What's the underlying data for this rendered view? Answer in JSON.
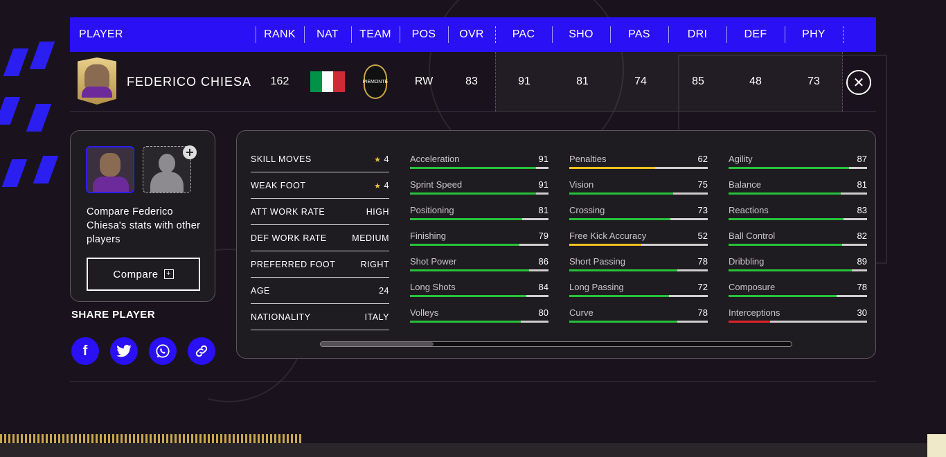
{
  "header": {
    "columns": [
      "PLAYER",
      "RANK",
      "NAT",
      "TEAM",
      "POS",
      "OVR",
      "PAC",
      "SHO",
      "PAS",
      "DRI",
      "DEF",
      "PHY"
    ]
  },
  "player": {
    "name": "FEDERICO CHIESA",
    "rank": "162",
    "position": "RW",
    "ovr": "83",
    "face_stats": [
      "91",
      "81",
      "74",
      "85",
      "48",
      "73"
    ],
    "team_crest_text": "PIEMONTE",
    "flag_colors": [
      "#009246",
      "#ffffff",
      "#ce2b37"
    ]
  },
  "compare": {
    "text": "Compare Federico Chiesa's stats with other players",
    "button_label": "Compare"
  },
  "share": {
    "title": "SHARE PLAYER",
    "buttons": [
      "facebook-icon",
      "twitter-icon",
      "whatsapp-icon",
      "link-icon"
    ]
  },
  "info": [
    {
      "label": "SKILL MOVES",
      "value": "4",
      "stars": true
    },
    {
      "label": "WEAK FOOT",
      "value": "4",
      "stars": true
    },
    {
      "label": "ATT WORK RATE",
      "value": "HIGH"
    },
    {
      "label": "DEF WORK RATE",
      "value": "MEDIUM"
    },
    {
      "label": "PREFERRED FOOT",
      "value": "RIGHT"
    },
    {
      "label": "AGE",
      "value": "24"
    },
    {
      "label": "NATIONALITY",
      "value": "ITALY"
    }
  ],
  "attributes": [
    [
      {
        "label": "Acceleration",
        "value": 91
      },
      {
        "label": "Sprint Speed",
        "value": 91
      },
      {
        "label": "Positioning",
        "value": 81
      },
      {
        "label": "Finishing",
        "value": 79
      },
      {
        "label": "Shot Power",
        "value": 86
      },
      {
        "label": "Long Shots",
        "value": 84
      },
      {
        "label": "Volleys",
        "value": 80
      }
    ],
    [
      {
        "label": "Penalties",
        "value": 62
      },
      {
        "label": "Vision",
        "value": 75
      },
      {
        "label": "Crossing",
        "value": 73
      },
      {
        "label": "Free Kick Accuracy",
        "value": 52
      },
      {
        "label": "Short Passing",
        "value": 78
      },
      {
        "label": "Long Passing",
        "value": 72
      },
      {
        "label": "Curve",
        "value": 78
      }
    ],
    [
      {
        "label": "Agility",
        "value": 87
      },
      {
        "label": "Balance",
        "value": 81
      },
      {
        "label": "Reactions",
        "value": 83
      },
      {
        "label": "Ball Control",
        "value": 82
      },
      {
        "label": "Dribbling",
        "value": 89
      },
      {
        "label": "Composure",
        "value": 78
      },
      {
        "label": "Interceptions",
        "value": 30
      }
    ]
  ],
  "colors": {
    "accent": "#2a10f5",
    "bar_high": "#27c23a",
    "bar_mid": "#f0c020",
    "bar_low": "#e0242a"
  }
}
